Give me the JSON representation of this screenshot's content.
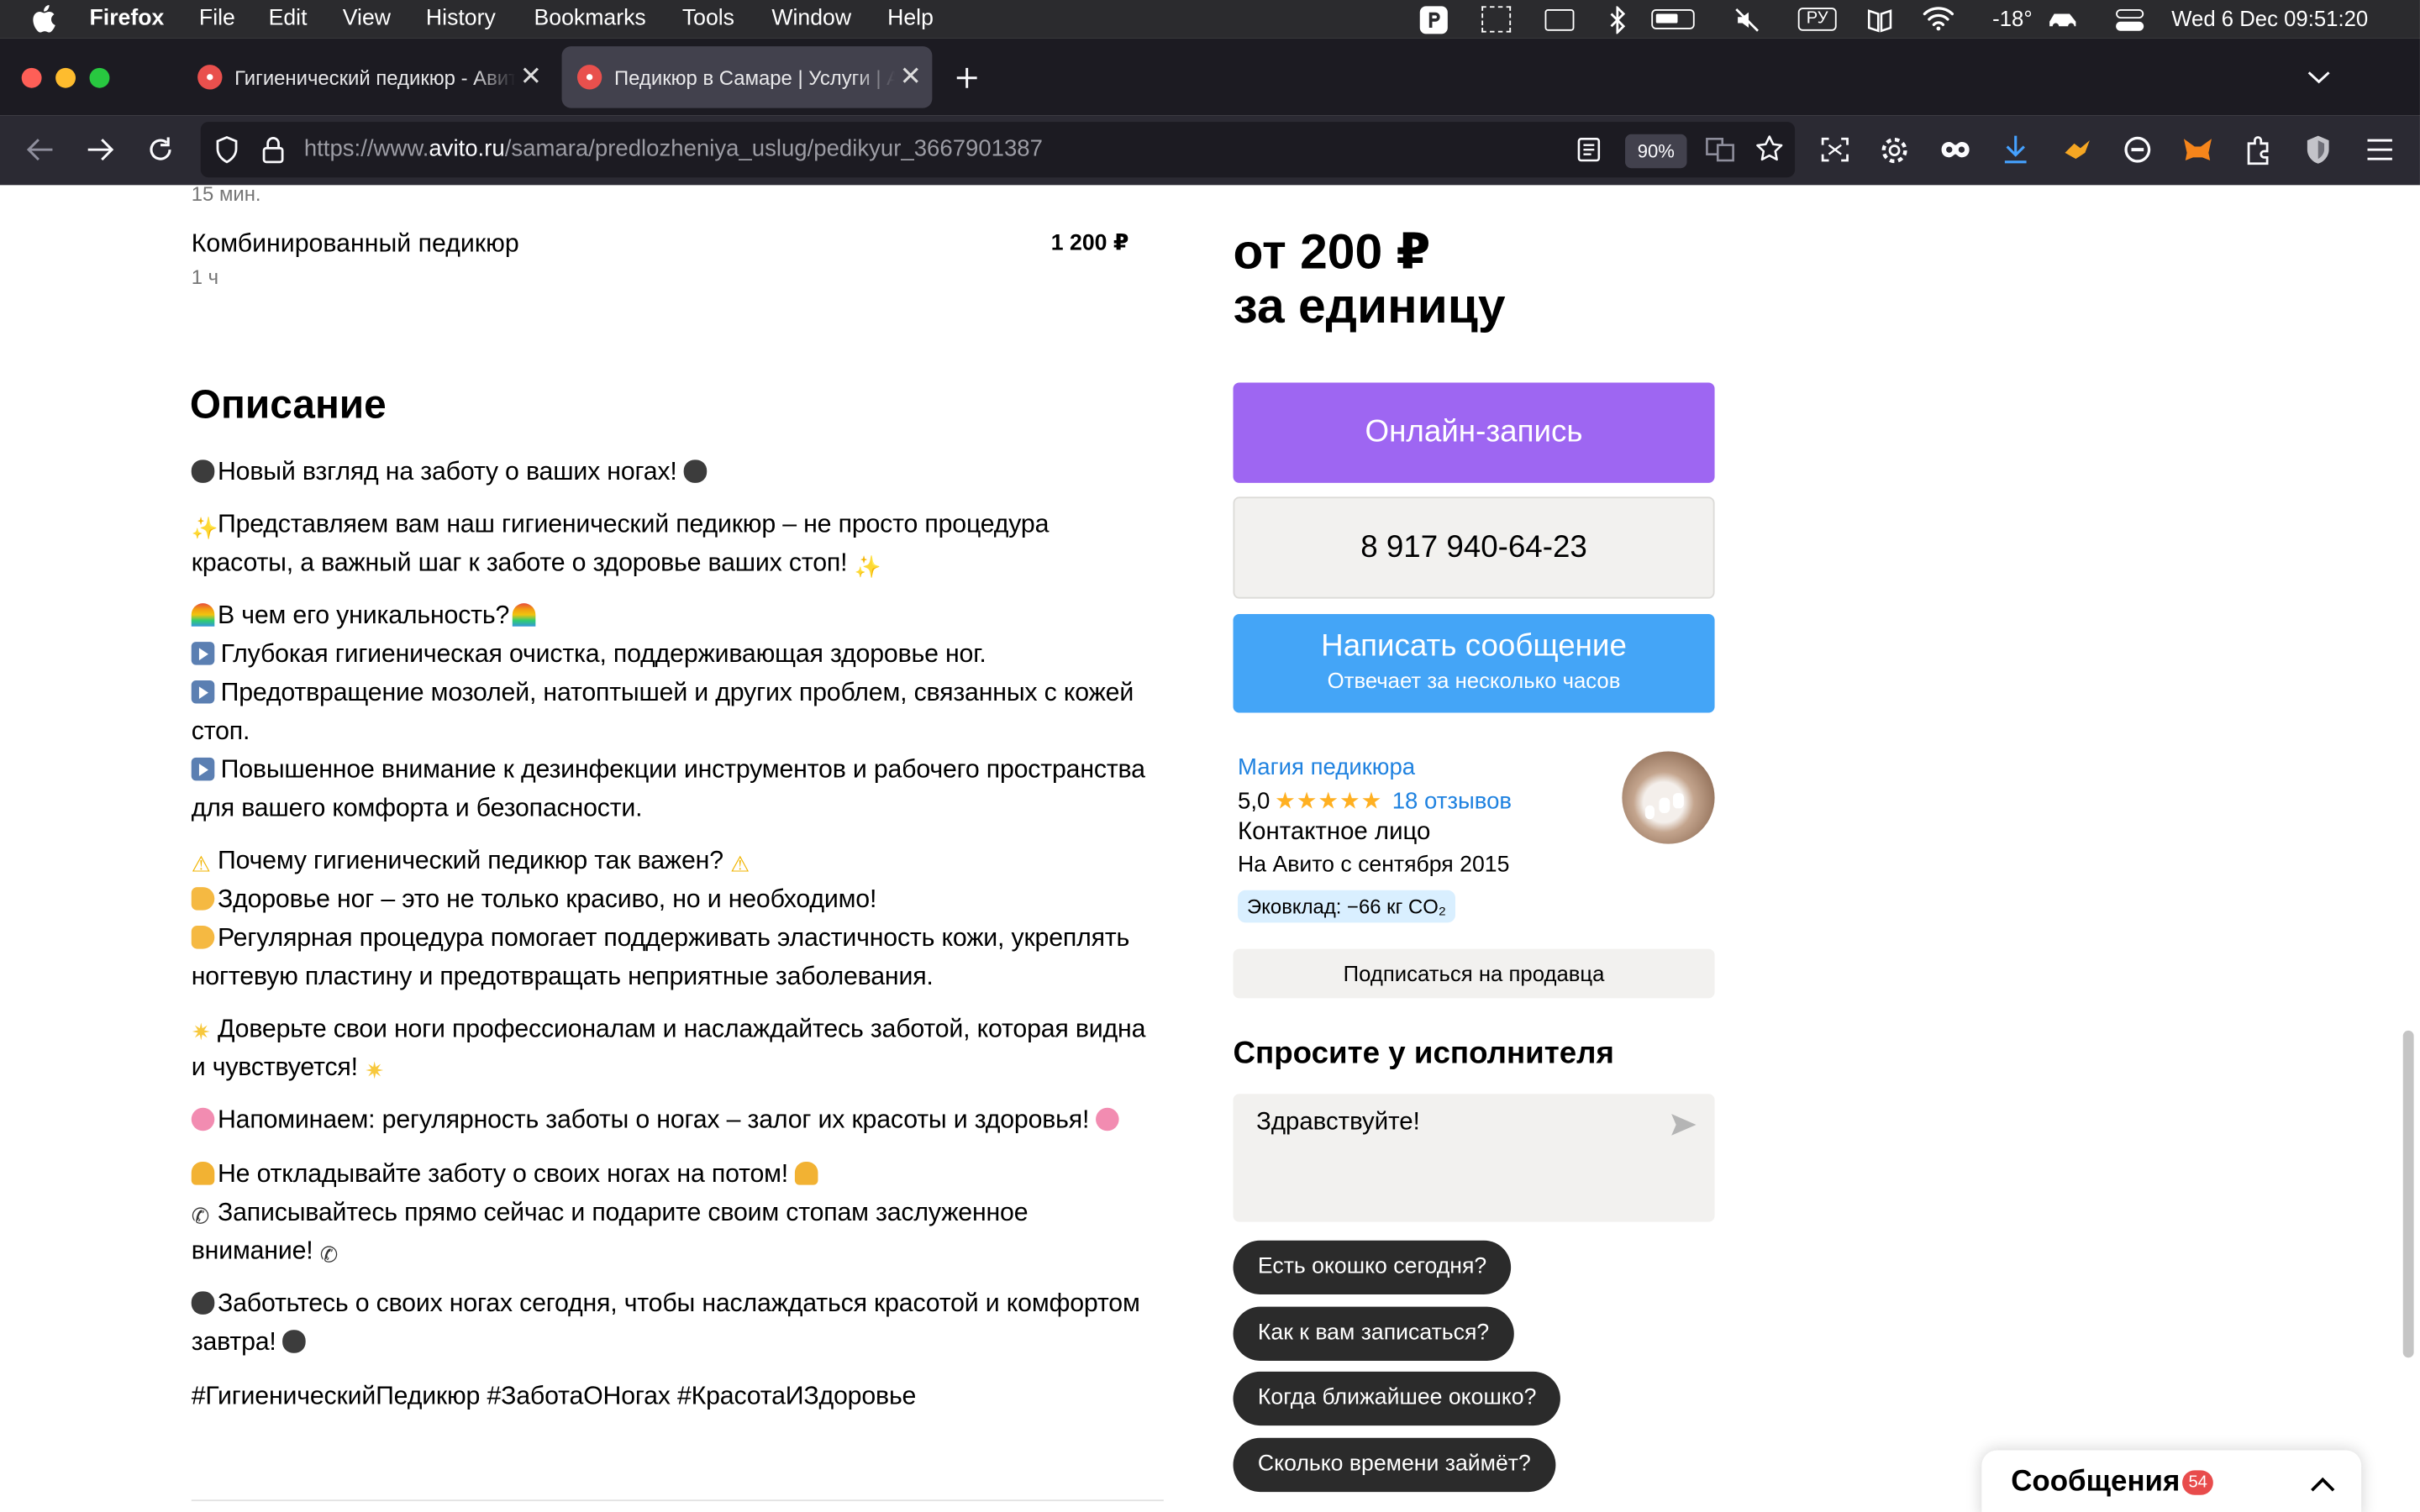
{
  "menubar": {
    "app": "Firefox",
    "menus": [
      "File",
      "Edit",
      "View",
      "History",
      "Bookmarks",
      "Tools",
      "Window",
      "Help"
    ],
    "lang": "РУ",
    "temperature": "-18°",
    "datetime": "Wed 6 Dec  09:51:20"
  },
  "tabs": [
    {
      "title": "Гигиенический педикюр - Авито"
    },
    {
      "title": "Педикюр в Самаре | Услуги | Авито"
    }
  ],
  "navbar": {
    "url_prefix": "https://www.",
    "url_domain": "avito.ru",
    "url_path": "/samara/predlozheniya_uslug/pedikyur_3667901387",
    "zoom": "90%"
  },
  "services": {
    "prev_duration": "15 мин.",
    "item_name": "Комбинированный педикюр",
    "item_duration": "1 ч",
    "item_price": "1 200 ₽"
  },
  "description": {
    "heading": "Описание",
    "lines": [
      "Новый взгляд на заботу о ваших ногах!",
      "Представляем вам наш гигиенический педикюр – не просто процедура",
      "красоты, а важный шаг к заботе о здоровье ваших стоп!",
      "В чем его уникальность?",
      "Глубокая гигиеническая очистка, поддерживающая здоровье ног.",
      "Предотвращение мозолей, натоптышей и других проблем, связанных с кожей",
      "стоп.",
      "Повышенное внимание к дезинфекции инструментов и рабочего пространства",
      "для вашего комфорта и безопасности.",
      "Почему гигиенический педикюр так важен?",
      "Здоровье ног – это не только красиво, но и необходимо!",
      "Регулярная процедура помогает поддерживать эластичность кожи, укреплять",
      "ногтевую пластину и предотвращать неприятные заболевания.",
      "Доверьте свои ноги профессионалам и наслаждайтесь заботой, которая видна",
      "и чувствуется!",
      "Напоминаем: регулярность заботы о ногах – залог их красоты и здоровья!",
      "Не откладывайте заботу о своих ногах на потом!",
      "Записывайтесь прямо сейчас и подарите своим стопам заслуженное",
      "внимание!",
      "Заботьтесь о своих ногах сегодня, чтобы наслаждаться красотой и комфортом",
      "завтра!",
      "#ГигиеническийПедикюр #ЗаботаОНогах #КрасотаИЗдоровье"
    ]
  },
  "sidebar": {
    "price_line1": "от 200 ₽",
    "price_line2": "за единицу",
    "online_booking": "Онлайн-запись",
    "phone": "8 917 940-64-23",
    "message_button": "Написать сообщение",
    "message_sub": "Отвечает за несколько часов",
    "seller_name": "Магия педикюра",
    "rating": "5,0",
    "stars": 5,
    "reviews": "18 отзывов",
    "contact_type": "Контактное лицо",
    "since": "На Авито с сентября 2015",
    "eco": "Эковклад: −66 кг CO₂",
    "subscribe": "Подписаться на продавца",
    "ask_heading": "Спросите у исполнителя",
    "ask_input": "Здравствуйте!",
    "chips": [
      "Есть окошко сегодня?",
      "Как к вам записаться?",
      "Когда ближайшее окошко?",
      "Сколько времени займёт?"
    ]
  },
  "messages_panel": {
    "label": "Сообщения",
    "count": "54"
  },
  "colors": {
    "online_booking": "#9e66f2",
    "message_button": "#44a5f7",
    "phone_bg": "#f2f1ef",
    "link": "#1f82e0",
    "star": "#ffb021",
    "badge": "#e84c4c"
  }
}
